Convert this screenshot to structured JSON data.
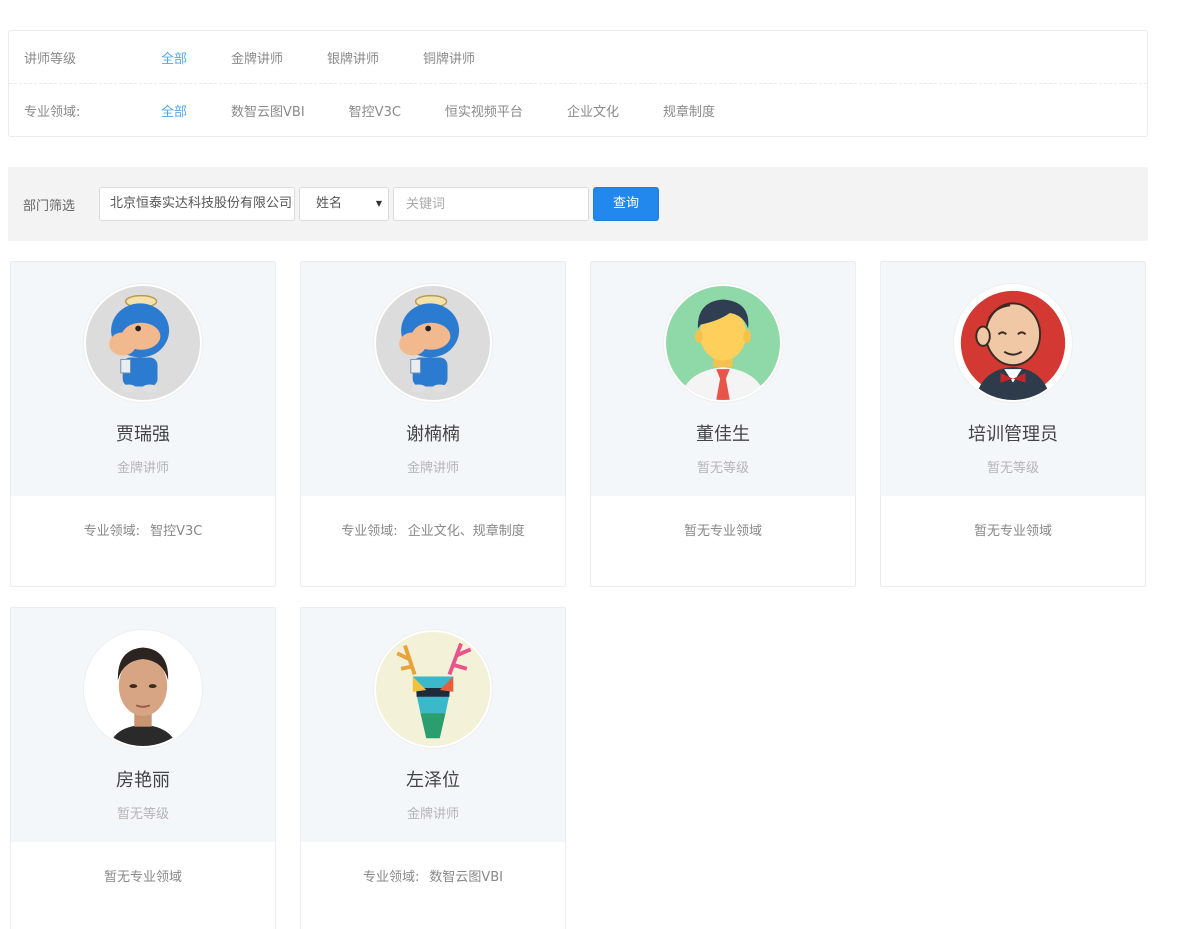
{
  "filters": {
    "level": {
      "label": "讲师等级",
      "options": [
        "全部",
        "金牌讲师",
        "银牌讲师",
        "铜牌讲师"
      ],
      "active": "全部"
    },
    "field": {
      "label": "专业领域:",
      "options": [
        "全部",
        "数智云图VBI",
        "智控V3C",
        "恒实视频平台",
        "企业文化",
        "规章制度"
      ],
      "active": "全部"
    }
  },
  "search": {
    "dept_label": "部门筛选",
    "dept_value": "北京恒泰实达科技股份有限公司",
    "select_value": "姓名",
    "keyword_placeholder": "关键词",
    "query_label": "查询"
  },
  "colors": {
    "accent": "#52a8e8",
    "button": "#2288ee",
    "card_top": "#f4f7fa"
  },
  "cards": [
    {
      "name": "贾瑞强",
      "level": "金牌讲师",
      "domain_label": "专业领域:",
      "domain_value": "智控V3C",
      "avatar": "camel-mascot-avatar"
    },
    {
      "name": "谢楠楠",
      "level": "金牌讲师",
      "domain_label": "专业领域:",
      "domain_value": "企业文化、规章制度",
      "avatar": "camel-mascot-avatar"
    },
    {
      "name": "董佳生",
      "level": "暂无等级",
      "domain_label": "",
      "domain_value": "暂无专业领域",
      "avatar": "default-male-avatar"
    },
    {
      "name": "培训管理员",
      "level": "暂无等级",
      "domain_label": "",
      "domain_value": "暂无专业领域",
      "avatar": "butler-avatar"
    },
    {
      "name": "房艳丽",
      "level": "暂无等级",
      "domain_label": "",
      "domain_value": "暂无专业领域",
      "avatar": "portrait-photo-avatar"
    },
    {
      "name": "左泽位",
      "level": "金牌讲师",
      "domain_label": "专业领域:",
      "domain_value": "数智云图VBI",
      "avatar": "deer-avatar"
    }
  ]
}
